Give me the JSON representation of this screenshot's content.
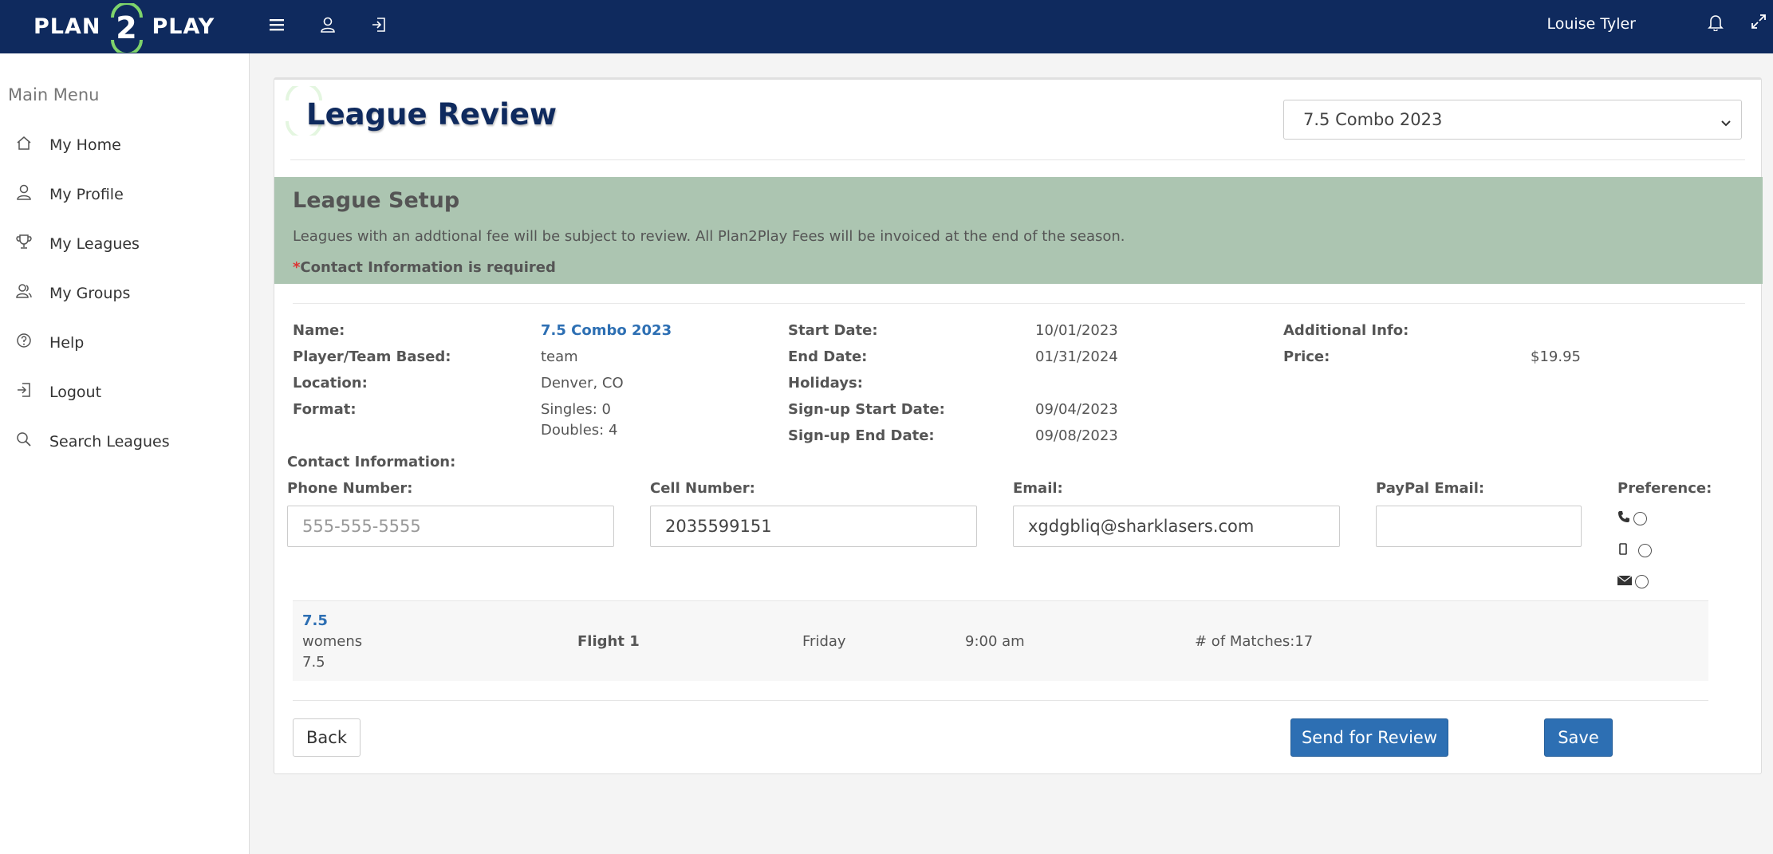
{
  "header": {
    "logo_left": "PLAN",
    "logo_number": "2",
    "logo_right": "PLAY",
    "user_name": "Louise Tyler",
    "icons": [
      "menu-icon",
      "user-icon",
      "sign-out-icon",
      "bell-icon",
      "expand-icon"
    ]
  },
  "sidebar": {
    "heading": "Main Menu",
    "items": [
      {
        "label": "My Home",
        "icon": "home-icon"
      },
      {
        "label": "My Profile",
        "icon": "user-icon"
      },
      {
        "label": "My Leagues",
        "icon": "trophy-icon"
      },
      {
        "label": "My Groups",
        "icon": "group-icon"
      },
      {
        "label": "Help",
        "icon": "help-icon"
      },
      {
        "label": "Logout",
        "icon": "logout-icon"
      },
      {
        "label": "Search Leagues",
        "icon": "search-icon"
      }
    ]
  },
  "page": {
    "title": "League Review",
    "season_select": "7.5 Combo 2023"
  },
  "setup": {
    "title": "League Setup",
    "note": "Leagues with an addtional fee will be subject to review. All Plan2Play Fees will be invoiced at the end of the season.",
    "required_star": "*",
    "required_text": "Contact Information is required"
  },
  "details": {
    "name_label": "Name:",
    "name_value": "7.5 Combo 2023",
    "based_label": "Player/Team Based:",
    "based_value": "team",
    "location_label": "Location:",
    "location_value": "Denver, CO",
    "format_label": "Format:",
    "singles": "Singles: 0",
    "doubles": "Doubles: 4",
    "start_label": "Start Date:",
    "start_value": "10/01/2023",
    "end_label": "End Date:",
    "end_value": "01/31/2024",
    "holidays_label": "Holidays:",
    "signup_start_label": "Sign-up Start Date:",
    "signup_start_value": "09/04/2023",
    "signup_end_label": "Sign-up End Date:",
    "signup_end_value": "09/08/2023",
    "additional_label": "Additional Info:",
    "price_label": "Price:",
    "price_value": "$19.95"
  },
  "contact": {
    "heading": "Contact Information:",
    "phone_label": "Phone Number:",
    "phone_placeholder": "555-555-5555",
    "phone_value": "",
    "cell_label": "Cell Number:",
    "cell_value": "2035599151",
    "email_label": "Email:",
    "email_value": "xgdgbliq@sharklasers.com",
    "paypal_label": "PayPal Email:",
    "paypal_value": "",
    "preference_label": "Preference:",
    "preference_options": [
      "phone-icon",
      "mobile-icon",
      "envelope-icon"
    ]
  },
  "flight": {
    "level": "7.5",
    "gender": "womens",
    "level_sub": "7.5",
    "flight": "Flight 1",
    "day": "Friday",
    "time": "9:00 am",
    "matches": "# of Matches:17"
  },
  "buttons": {
    "back": "Back",
    "send": "Send for Review",
    "save": "Save"
  },
  "colors": {
    "navbar": "#0f2a5e",
    "setup_band": "#acc5b1",
    "primary": "#2d6fb3",
    "logo_accent": "#7ed36b"
  }
}
